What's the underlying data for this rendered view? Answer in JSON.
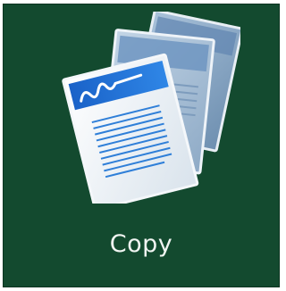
{
  "tile": {
    "label": "Copy",
    "icon": "copy-documents-icon"
  },
  "colors": {
    "background": "#134a2f",
    "label": "#f1f5f2",
    "accent": "#1f6ed4"
  }
}
